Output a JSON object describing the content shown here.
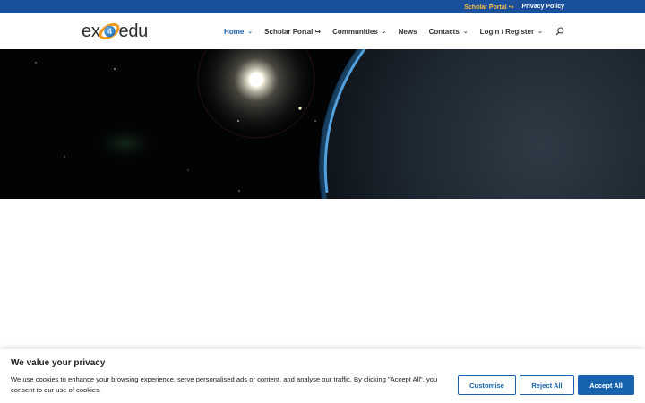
{
  "topbar": {
    "scholar_portal": "Scholar Portal ↪",
    "privacy_policy": "Privacy Policy"
  },
  "logo": {
    "left": "ex",
    "mark_number": "4",
    "right": "edu"
  },
  "nav": {
    "items": [
      {
        "label": "Home",
        "suffix": "⌄"
      },
      {
        "label": "Scholar Portal",
        "suffix": "↪"
      },
      {
        "label": "Communities",
        "suffix": "⌄"
      },
      {
        "label": "News",
        "suffix": ""
      },
      {
        "label": "Contacts",
        "suffix": "⌄"
      },
      {
        "label": "Login / Register",
        "suffix": "⌄"
      }
    ],
    "active_index": 0
  },
  "cookie": {
    "title": "We value your privacy",
    "text": "We use cookies to enhance your browsing experience, serve personalised ads or content, and analyse our traffic. By clicking \"Accept All\", you consent to our use of cookies.",
    "customise": "Customise",
    "reject": "Reject All",
    "accept": "Accept All"
  },
  "colors": {
    "topbar_bg": "#1a4f9c",
    "topbar_highlight": "#f6c044",
    "accent": "#1863b0",
    "nav_active": "#1a5ea8"
  },
  "icons": {
    "search": "search-icon",
    "logo_mark": "orbit-planet-icon"
  }
}
